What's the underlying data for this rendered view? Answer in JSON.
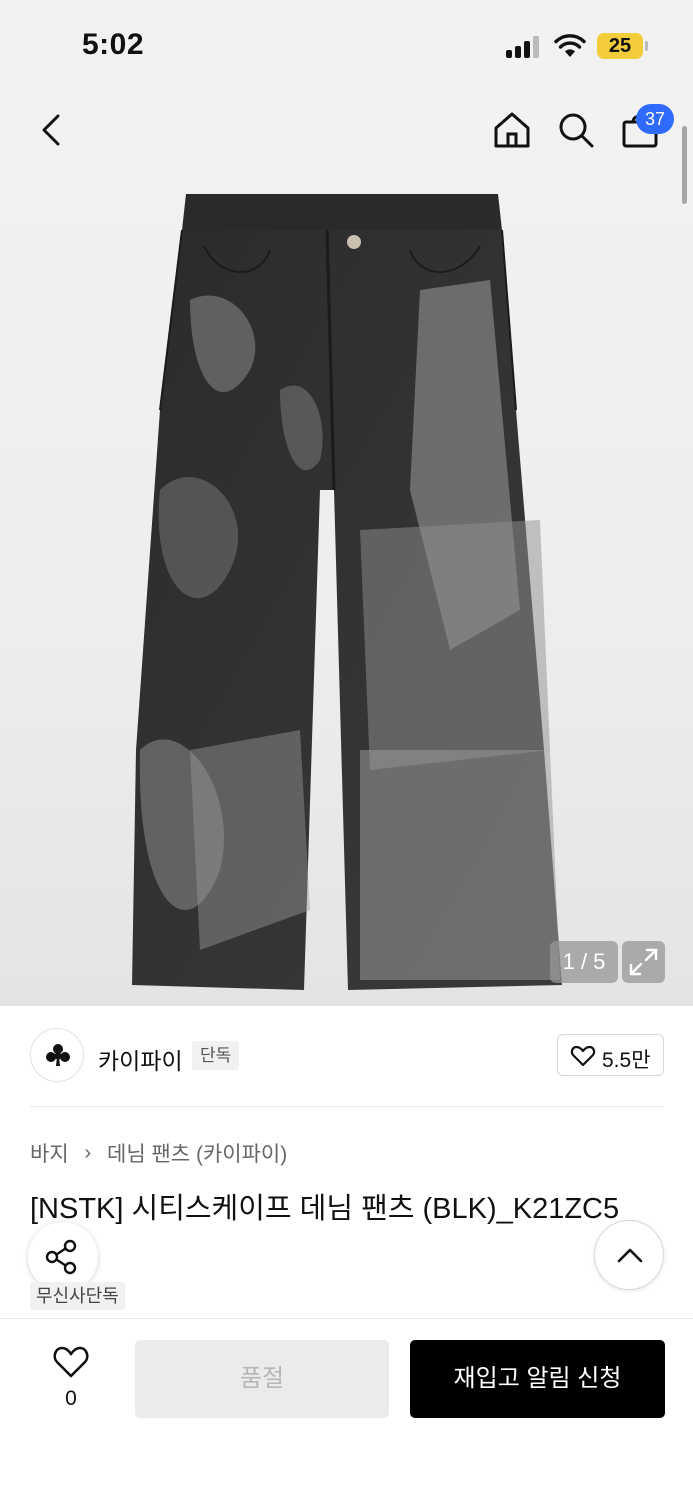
{
  "status_bar": {
    "time": "5:02",
    "battery": "25",
    "icons": [
      "signal-icon",
      "wifi-icon",
      "battery-icon"
    ]
  },
  "top_nav": {
    "icons": [
      "back-arrow-icon",
      "home-icon",
      "search-icon",
      "cart-icon"
    ],
    "cart_badge": "37"
  },
  "gallery": {
    "current_page": 1,
    "total_pages": 5,
    "counter": "1 / 5",
    "expand_icon": "expand-icon"
  },
  "brand": {
    "logo_icon": "club-icon",
    "name": "카이파이",
    "tag": "단독",
    "likes": "5.5만"
  },
  "product": {
    "breadcrumb": [
      "바지",
      "데님 팬츠 (카이파이)"
    ],
    "title": "[NSTK] 시티스케이프 데님 팬츠 (BLK)_K21ZC5",
    "title_continued": "(",
    "tag": "무신사단독"
  },
  "floating": {
    "share_icon": "share-icon",
    "top_icon": "chevron-up-icon"
  },
  "bottom_bar": {
    "wish_count": "0",
    "soldout_label": "품절",
    "restock_label": "재입고 알림 신청"
  },
  "colors": {
    "badge": "#2f6bff",
    "battery": "#f2cc3a",
    "primary_button": "#000000"
  }
}
